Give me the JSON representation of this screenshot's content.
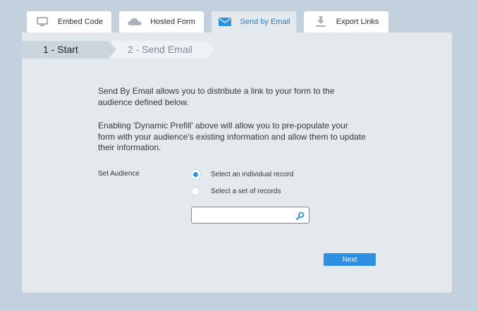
{
  "tabs": [
    {
      "label": "Embed Code",
      "icon": "monitor-icon"
    },
    {
      "label": "Hosted Form",
      "icon": "cloud-icon"
    },
    {
      "label": "Send by Email",
      "icon": "envelope-icon",
      "active": true
    },
    {
      "label": "Export Links",
      "icon": "download-icon"
    }
  ],
  "steps": [
    {
      "label": "1 - Start",
      "active": true
    },
    {
      "label": "2 - Send Email",
      "active": false
    }
  ],
  "description": {
    "paragraph1": "Send By Email allows you to distribute a link to your form to the audience defined below.",
    "paragraph2": "Enabling 'Dynamic Prefill' above will allow you to pre-populate your form with your audience's existing information and allow them to update their information."
  },
  "audience": {
    "label": "Set Audience",
    "options": [
      {
        "label": "Select an individual record",
        "selected": true
      },
      {
        "label": "Select a set of records",
        "selected": false
      }
    ],
    "search_value": "",
    "search_placeholder": ""
  },
  "next_label": "Next",
  "colors": {
    "background": "#c3d1de",
    "panel": "#e4e9ee",
    "accent": "#2f8fe0",
    "active_tab_text": "#2b7fc0"
  }
}
